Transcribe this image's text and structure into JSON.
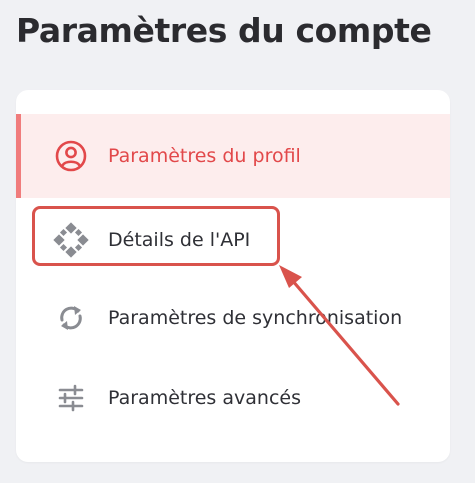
{
  "page": {
    "title": "Paramètres du compte"
  },
  "menu": {
    "items": [
      {
        "label": "Paramètres du profil",
        "icon": "user-circle-icon",
        "active": true
      },
      {
        "label": "Détails de l'API",
        "icon": "api-diamond-icon",
        "active": false
      },
      {
        "label": "Paramètres de synchronisation",
        "icon": "sync-icon",
        "active": false
      },
      {
        "label": "Paramètres avancés",
        "icon": "sliders-icon",
        "active": false
      }
    ]
  },
  "colors": {
    "active_text": "#e2484a",
    "active_background": "#fdeded",
    "active_bar": "#f07c7c",
    "annotation": "#d9534c",
    "icon_gray": "#8a8c92"
  }
}
